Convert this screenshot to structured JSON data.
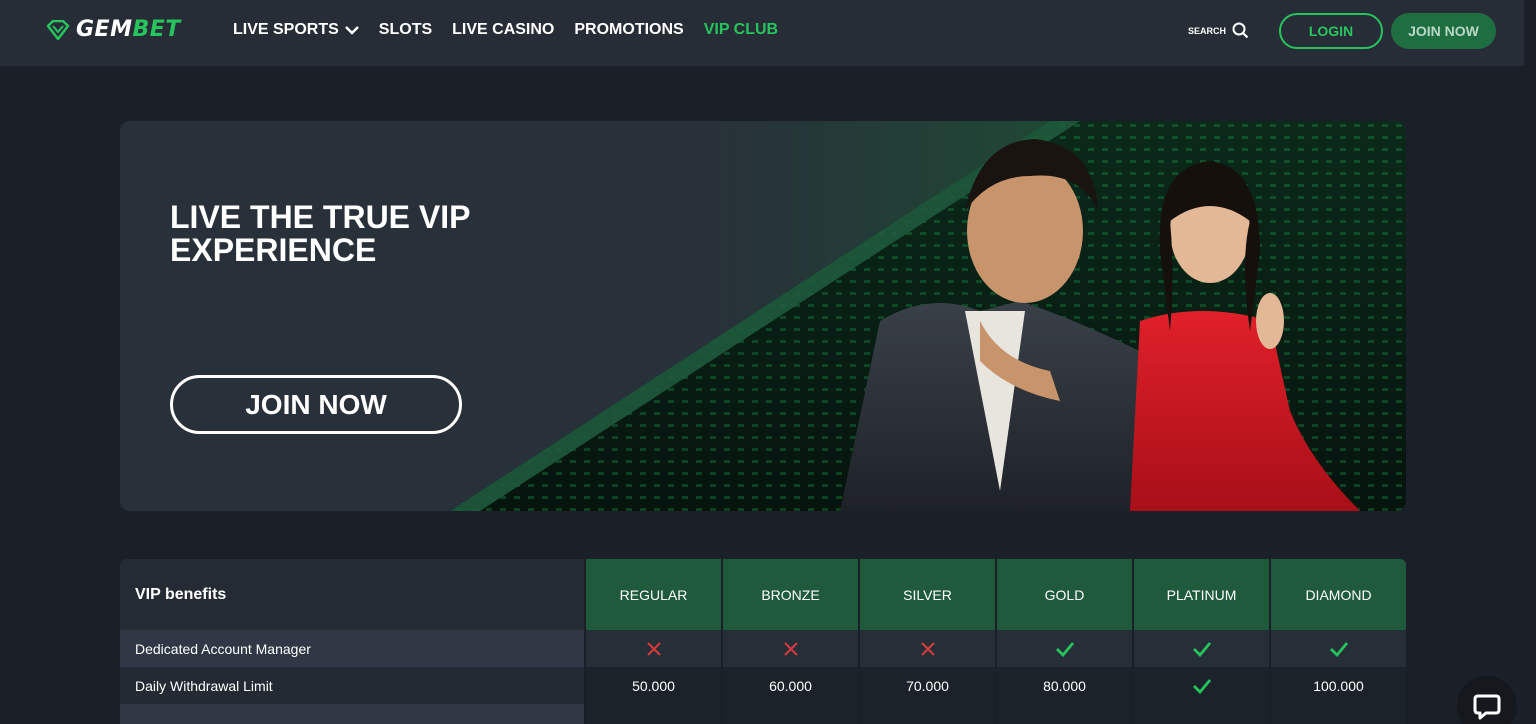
{
  "brand": {
    "name_part1": "GEM",
    "name_part2": "BET",
    "accent": "#27c45e"
  },
  "nav": {
    "items": [
      {
        "label": "LIVE SPORTS"
      },
      {
        "label": "SLOTS"
      },
      {
        "label": "LIVE CASINO"
      },
      {
        "label": "PROMOTIONS"
      },
      {
        "label": "VIP CLUB"
      }
    ]
  },
  "header": {
    "search_label": "SEARCH",
    "login_label": "LOGIN",
    "join_label": "JOIN NOW"
  },
  "banner": {
    "title": "LIVE THE TRUE VIP EXPERIENCE",
    "button_label": "JOIN NOW"
  },
  "table": {
    "header_label": "VIP benefits",
    "tiers": [
      "REGULAR",
      "BRONZE",
      "SILVER",
      "GOLD",
      "PLATINUM",
      "DIAMOND"
    ],
    "rows": [
      {
        "label": "Dedicated Account Manager",
        "values": [
          "cross-icon",
          "cross-icon",
          "cross-icon",
          "check-icon",
          "check-icon",
          "check-icon"
        ]
      },
      {
        "label": "Daily Withdrawal Limit",
        "values": [
          "50.000",
          "60.000",
          "70.000",
          "80.000",
          "check-icon",
          "100.000"
        ]
      }
    ]
  },
  "colors": {
    "check": "#27c45e",
    "cross": "#d63a3a"
  }
}
